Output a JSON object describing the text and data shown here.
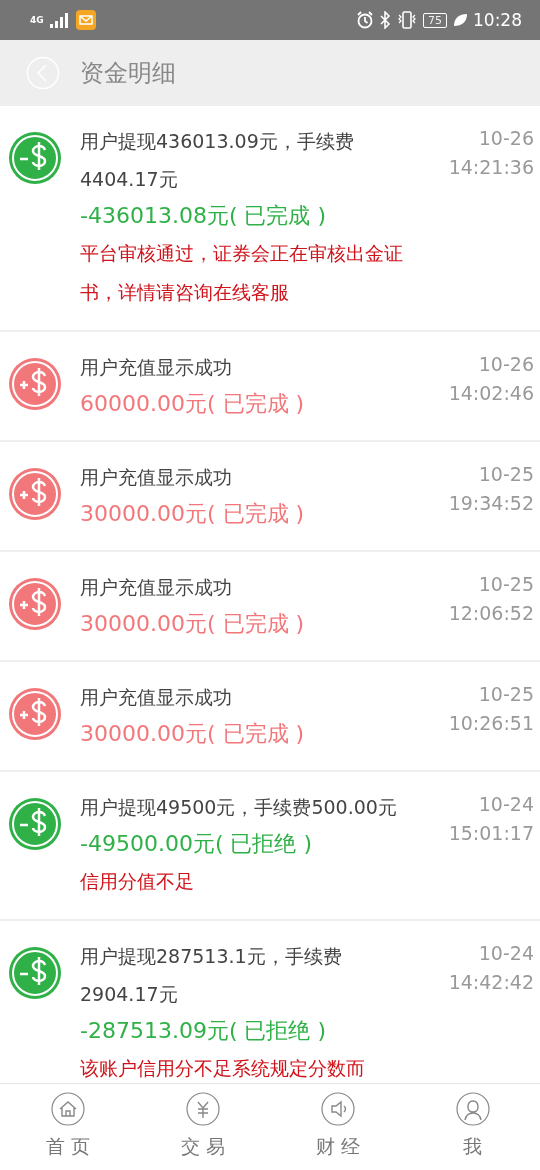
{
  "status_bar": {
    "network": "4G",
    "battery": "75",
    "time": "10:28"
  },
  "header": {
    "title": "资金明细"
  },
  "records": [
    {
      "kind": "withdraw",
      "description": "用户提现436013.09元，手续费4404.17元",
      "amount": "-436013.08元( 已完成 )",
      "note": "平台审核通过，证券会正在审核出金证书，详情请咨询在线客服",
      "date": "10-26",
      "time": "14:21:36"
    },
    {
      "kind": "deposit",
      "description": "用户充值显示成功",
      "amount": "60000.00元( 已完成 )",
      "date": "10-26",
      "time": "14:02:46"
    },
    {
      "kind": "deposit",
      "description": "用户充值显示成功",
      "amount": "30000.00元( 已完成 )",
      "date": "10-25",
      "time": "19:34:52"
    },
    {
      "kind": "deposit",
      "description": "用户充值显示成功",
      "amount": "30000.00元( 已完成 )",
      "date": "10-25",
      "time": "12:06:52"
    },
    {
      "kind": "deposit",
      "description": "用户充值显示成功",
      "amount": "30000.00元( 已完成 )",
      "date": "10-25",
      "time": "10:26:51"
    },
    {
      "kind": "withdraw",
      "description": "用户提现49500元，手续费500.00元",
      "amount": "-49500.00元( 已拒绝 )",
      "note": "信用分值不足",
      "date": "10-24",
      "time": "15:01:17"
    },
    {
      "kind": "withdraw",
      "description": "用户提现287513.1元，手续费2904.17元",
      "amount": "-287513.09元( 已拒绝 )",
      "note": "该账户信用分不足系统规定分数而",
      "date": "10-24",
      "time": "14:42:42"
    }
  ],
  "nav": [
    {
      "kind": "home",
      "label": "首页"
    },
    {
      "kind": "trade",
      "label": "交易"
    },
    {
      "kind": "finance",
      "label": "财经"
    },
    {
      "kind": "me",
      "label": "我"
    }
  ]
}
